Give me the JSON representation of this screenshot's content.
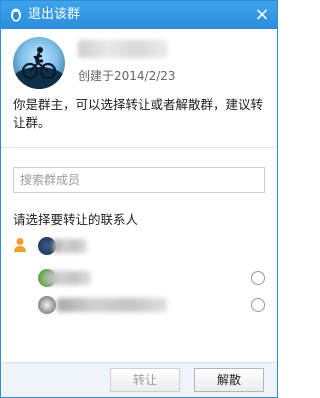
{
  "window": {
    "title": "退出该群",
    "close_symbol": "×"
  },
  "group": {
    "created_text": "创建于2014/2/23"
  },
  "notice": "你是群主，可以选择转让或者解散群，建议转让群。",
  "search": {
    "placeholder": "搜索群成员",
    "value": ""
  },
  "select_label": "请选择要转让的联系人",
  "contacts": [
    {
      "icon": "person-icon",
      "selectable": false
    },
    {
      "icon": "avatar",
      "selectable": true
    },
    {
      "icon": "avatar",
      "selectable": true
    }
  ],
  "buttons": {
    "transfer": "转让",
    "dissolve": "解散"
  },
  "colors": {
    "titlebar": "#2b8ddc",
    "border": "#2d8fd6",
    "footer": "#eef4f9",
    "person_icon": "#f0a030"
  },
  "icons": {
    "title": "qq-penguin-icon",
    "close": "close-icon",
    "group_avatar": "cyclist-avatar"
  }
}
